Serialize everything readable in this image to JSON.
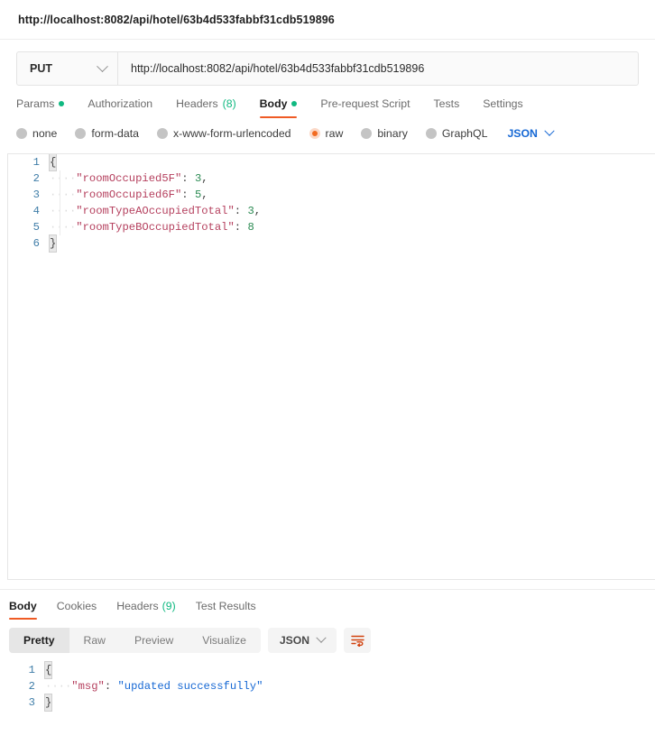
{
  "window": {
    "title": "http://localhost:8082/api/hotel/63b4d533fabbf31cdb519896"
  },
  "request": {
    "method": "PUT",
    "method_chevron_icon": "chevron-down-icon",
    "url": "http://localhost:8082/api/hotel/63b4d533fabbf31cdb519896",
    "url_placeholder": "Enter request URL",
    "tabs": [
      {
        "label": "Params",
        "dot": true,
        "count": "",
        "active": false
      },
      {
        "label": "Authorization",
        "dot": false,
        "count": "",
        "active": false
      },
      {
        "label": "Headers",
        "dot": false,
        "count": "(8)",
        "active": false
      },
      {
        "label": "Body",
        "dot": true,
        "count": "",
        "active": true
      },
      {
        "label": "Pre-request Script",
        "dot": false,
        "count": "",
        "active": false
      },
      {
        "label": "Tests",
        "dot": false,
        "count": "",
        "active": false
      },
      {
        "label": "Settings",
        "dot": false,
        "count": "",
        "active": false
      }
    ],
    "body_types": [
      {
        "label": "none",
        "selected": false
      },
      {
        "label": "form-data",
        "selected": false
      },
      {
        "label": "x-www-form-urlencoded",
        "selected": false
      },
      {
        "label": "raw",
        "selected": true
      },
      {
        "label": "binary",
        "selected": false
      },
      {
        "label": "GraphQL",
        "selected": false
      }
    ],
    "raw_format": "JSON",
    "raw_format_chevron_icon": "chevron-down-icon",
    "body_lines": [
      {
        "n": "1",
        "indent": 0,
        "key": "",
        "value": "",
        "type": "open-brace",
        "comma": false
      },
      {
        "n": "2",
        "indent": 1,
        "key": "\"roomOccupied5F\"",
        "value": "3",
        "type": "number",
        "comma": true
      },
      {
        "n": "3",
        "indent": 1,
        "key": "\"roomOccupied6F\"",
        "value": "5",
        "type": "number",
        "comma": true
      },
      {
        "n": "4",
        "indent": 1,
        "key": "\"roomTypeAOccupiedTotal\"",
        "value": "3",
        "type": "number",
        "comma": true
      },
      {
        "n": "5",
        "indent": 1,
        "key": "\"roomTypeBOccupiedTotal\"",
        "value": "8",
        "type": "number",
        "comma": false
      },
      {
        "n": "6",
        "indent": 0,
        "key": "",
        "value": "",
        "type": "close-brace",
        "comma": false
      }
    ]
  },
  "response": {
    "tabs": [
      {
        "label": "Body",
        "count": "",
        "active": true
      },
      {
        "label": "Cookies",
        "count": "",
        "active": false
      },
      {
        "label": "Headers",
        "count": "(9)",
        "active": false
      },
      {
        "label": "Test Results",
        "count": "",
        "active": false
      }
    ],
    "view_modes": [
      {
        "label": "Pretty",
        "active": true
      },
      {
        "label": "Raw",
        "active": false
      },
      {
        "label": "Preview",
        "active": false
      },
      {
        "label": "Visualize",
        "active": false
      }
    ],
    "format": "JSON",
    "format_chevron_icon": "chevron-down-icon",
    "wrap_icon": "text-wrap-icon",
    "body_lines": [
      {
        "n": "1",
        "indent": 0,
        "key": "",
        "value": "",
        "type": "open-brace",
        "comma": false
      },
      {
        "n": "2",
        "indent": 1,
        "key": "\"msg\"",
        "value": "\"updated successfully\"",
        "type": "string",
        "comma": false
      },
      {
        "n": "3",
        "indent": 0,
        "key": "",
        "value": "",
        "type": "close-brace",
        "comma": false
      }
    ]
  },
  "colors": {
    "accent_orange": "#ef5b25",
    "raw_orange": "#f26b21",
    "status_green": "#10b981",
    "link_blue": "#1668d4",
    "json_key": "#b5405e",
    "json_number": "#2a8a52",
    "json_string": "#1668d4",
    "gutter_blue": "#3f7da8"
  }
}
